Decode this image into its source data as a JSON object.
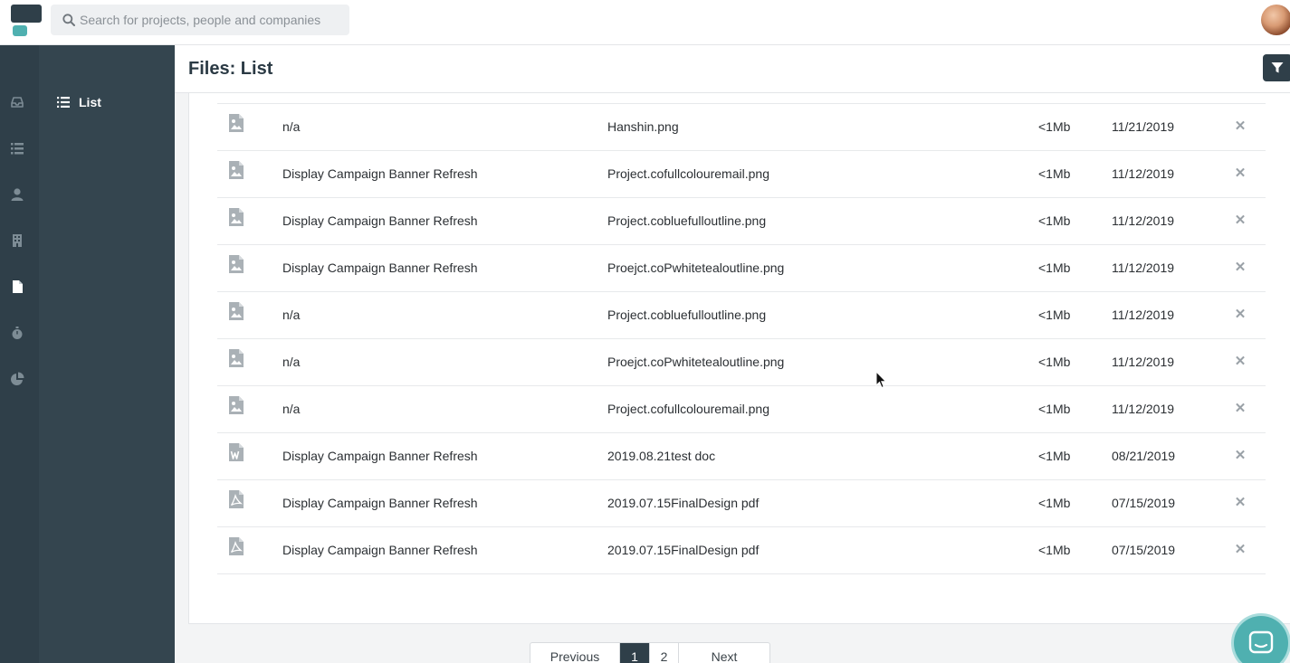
{
  "search": {
    "placeholder": "Search for projects, people and companies"
  },
  "rail": {
    "icons": [
      "inbox-icon",
      "list-icon",
      "person-icon",
      "building-icon",
      "file-icon",
      "stopwatch-icon",
      "pie-chart-icon"
    ]
  },
  "subnav": {
    "item_label": "List"
  },
  "page": {
    "title": "Files: List"
  },
  "files": [
    {
      "type": "image",
      "project": "n/a",
      "name": "Hanshin.png",
      "size": "<1Mb",
      "date": "11/21/2019"
    },
    {
      "type": "image",
      "project": "Display Campaign Banner Refresh",
      "name": "Project.cofullcolouremail.png",
      "size": "<1Mb",
      "date": "11/12/2019"
    },
    {
      "type": "image",
      "project": "Display Campaign Banner Refresh",
      "name": "Project.cobluefulloutline.png",
      "size": "<1Mb",
      "date": "11/12/2019"
    },
    {
      "type": "image",
      "project": "Display Campaign Banner Refresh",
      "name": "Proejct.coPwhitetealoutline.png",
      "size": "<1Mb",
      "date": "11/12/2019"
    },
    {
      "type": "image",
      "project": "n/a",
      "name": "Project.cobluefulloutline.png",
      "size": "<1Mb",
      "date": "11/12/2019"
    },
    {
      "type": "image",
      "project": "n/a",
      "name": "Proejct.coPwhitetealoutline.png",
      "size": "<1Mb",
      "date": "11/12/2019"
    },
    {
      "type": "image",
      "project": "n/a",
      "name": "Project.cofullcolouremail.png",
      "size": "<1Mb",
      "date": "11/12/2019"
    },
    {
      "type": "word",
      "project": "Display Campaign Banner Refresh",
      "name": "2019.08.21test doc",
      "size": "<1Mb",
      "date": "08/21/2019"
    },
    {
      "type": "pdf",
      "project": "Display Campaign Banner Refresh",
      "name": "2019.07.15FinalDesign pdf",
      "size": "<1Mb",
      "date": "07/15/2019"
    },
    {
      "type": "pdf",
      "project": "Display Campaign Banner Refresh",
      "name": "2019.07.15FinalDesign pdf",
      "size": "<1Mb",
      "date": "07/15/2019"
    }
  ],
  "delete_glyph": "✕",
  "pagination": {
    "previous": "Previous",
    "pages": [
      "1",
      "2"
    ],
    "current": "1",
    "next": "Next"
  },
  "colors": {
    "sidebar": "#2f3f49",
    "subnav": "#34454f",
    "accent": "#4fb0b0"
  }
}
